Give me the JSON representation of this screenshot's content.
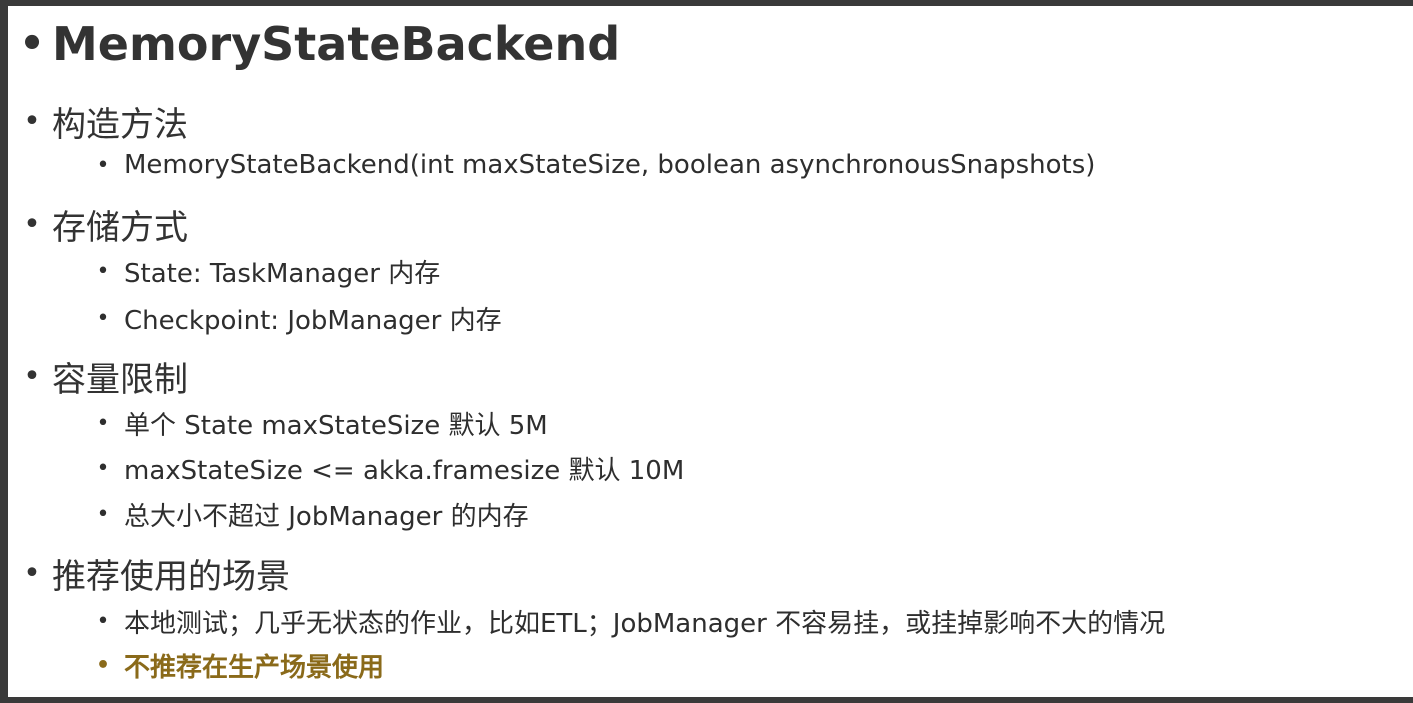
{
  "title": "MemoryStateBackend",
  "sections": [
    {
      "heading": "构造方法",
      "items": [
        "MemoryStateBackend(int maxStateSize, boolean asynchronousSnapshots)"
      ]
    },
    {
      "heading": "存储方式",
      "items": [
        "State: TaskManager 内存",
        "Checkpoint: JobManager 内存"
      ]
    },
    {
      "heading": "容量限制",
      "items": [
        "单个 State maxStateSize 默认 5M",
        "maxStateSize <= akka.framesize 默认 10M",
        "总大小不超过 JobManager 的内存"
      ]
    },
    {
      "heading": "推荐使用的场景",
      "items": [
        "本地测试；几乎无状态的作业，比如ETL；JobManager 不容易挂，或挂掉影响不大的情况",
        "不推荐在生产场景使用"
      ]
    }
  ],
  "bullet_char": "•",
  "colors": {
    "text": "#2e2e2e",
    "highlight": "#8a6a1a",
    "frame": "#3a3a3a",
    "background": "#ffffff"
  }
}
